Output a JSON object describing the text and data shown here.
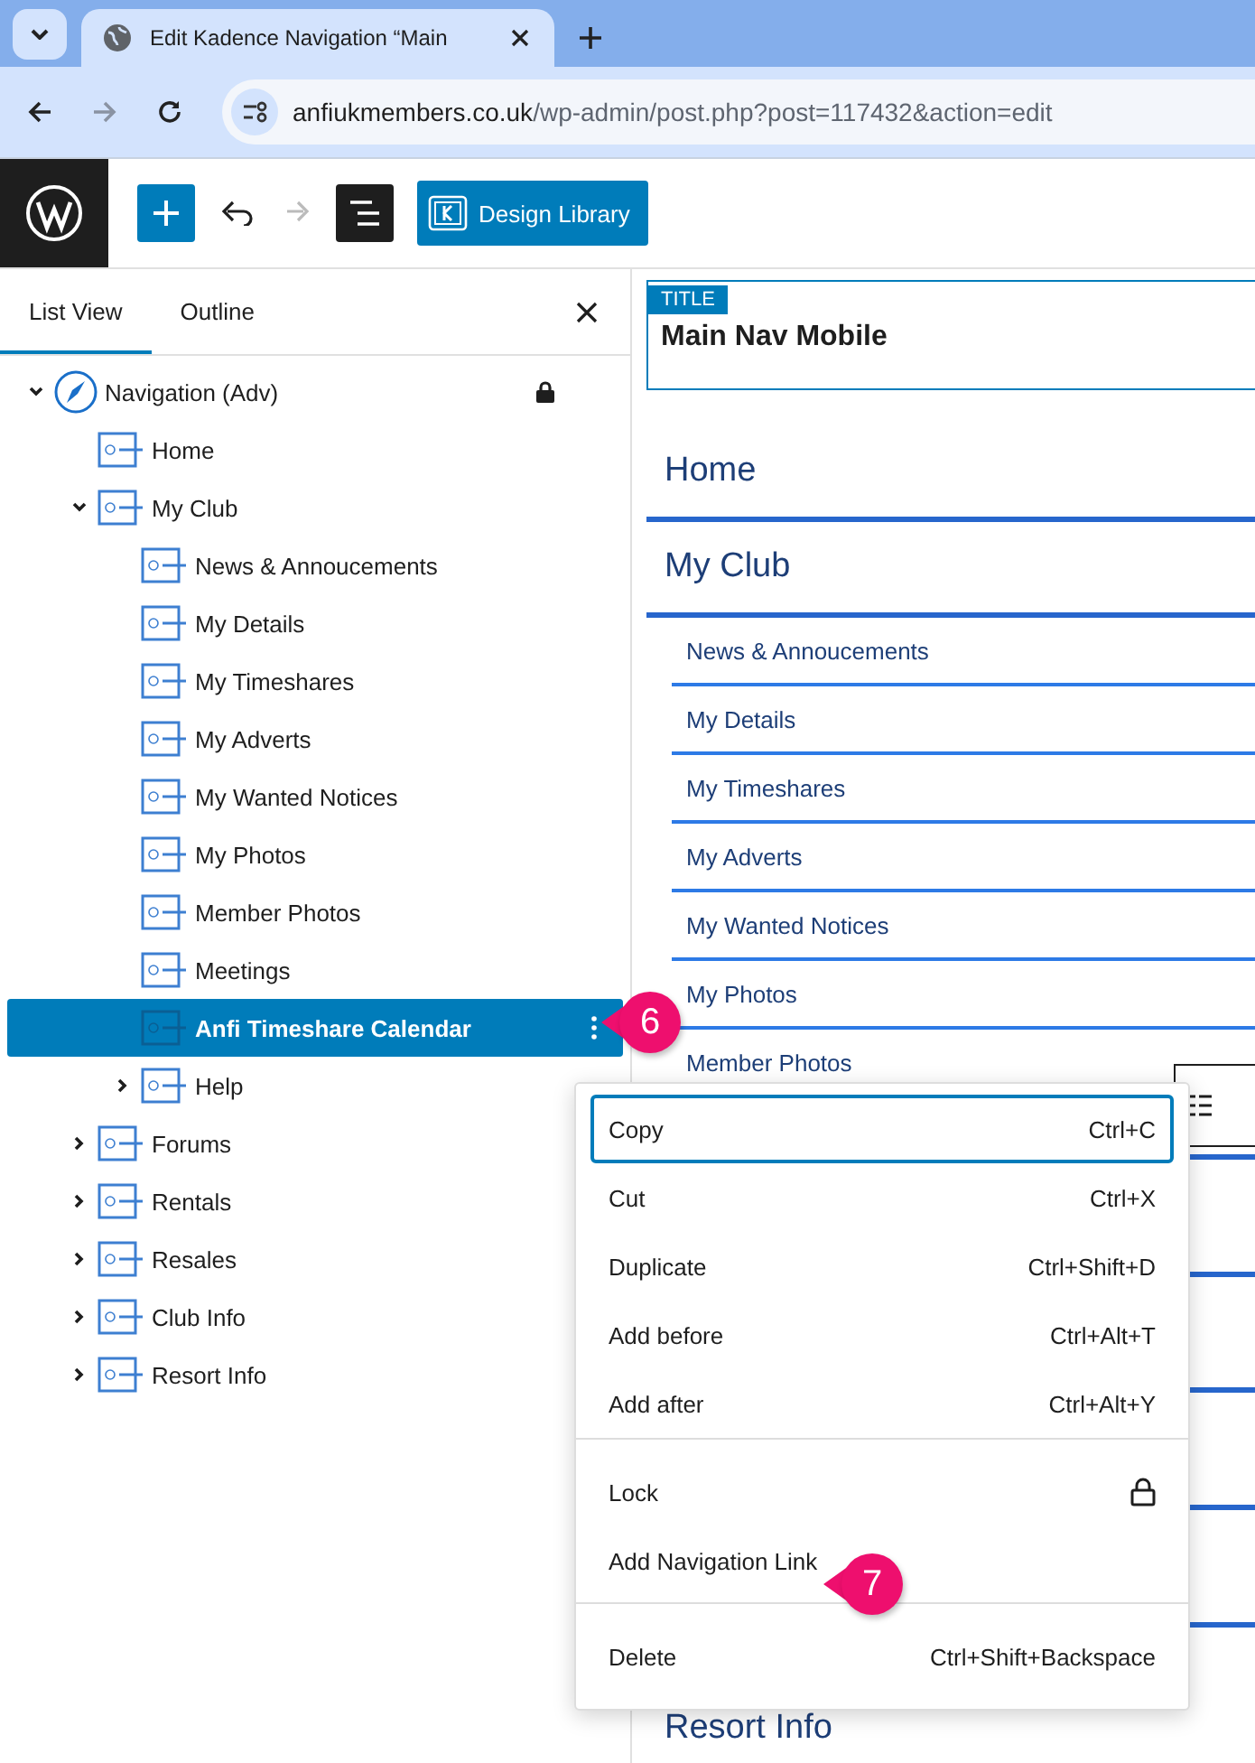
{
  "browser": {
    "tab_title": "Edit Kadence Navigation “Main",
    "address": {
      "domain": "anfiukmembers.co.uk",
      "path": "/wp-admin/post.php?post=117432&action=edit"
    }
  },
  "toolbar": {
    "library_button": "Design Library"
  },
  "list_panel": {
    "tabs": [
      {
        "label": "List View",
        "selected": true
      },
      {
        "label": "Outline",
        "selected": false
      }
    ],
    "tree": [
      {
        "label": "Navigation (Adv)",
        "kind": "navigation",
        "expanded": true,
        "locked": true,
        "selected": false,
        "children": [
          {
            "label": "Home",
            "kind": "link",
            "selected": false
          },
          {
            "label": "My Club",
            "kind": "link",
            "expanded": true,
            "selected": false,
            "children": [
              {
                "label": "News & Annoucements",
                "kind": "link",
                "selected": false
              },
              {
                "label": "My Details",
                "kind": "link",
                "selected": false
              },
              {
                "label": "My Timeshares",
                "kind": "link",
                "selected": false
              },
              {
                "label": "My Adverts",
                "kind": "link",
                "selected": false
              },
              {
                "label": "My Wanted Notices",
                "kind": "link",
                "selected": false
              },
              {
                "label": "My Photos",
                "kind": "link",
                "selected": false
              },
              {
                "label": "Member Photos",
                "kind": "link",
                "selected": false
              },
              {
                "label": "Meetings",
                "kind": "link",
                "selected": false
              },
              {
                "label": "Anfi Timeshare Calendar",
                "kind": "link",
                "selected": true
              },
              {
                "label": "Help",
                "kind": "link",
                "expanded": false,
                "selected": false
              }
            ]
          },
          {
            "label": "Forums",
            "kind": "link",
            "expanded": false,
            "selected": false
          },
          {
            "label": "Rentals",
            "kind": "link",
            "expanded": false,
            "selected": false
          },
          {
            "label": "Resales",
            "kind": "link",
            "expanded": false,
            "selected": false
          },
          {
            "label": "Club Info",
            "kind": "link",
            "expanded": false,
            "selected": false
          },
          {
            "label": "Resort Info",
            "kind": "link",
            "expanded": false,
            "selected": false
          }
        ]
      }
    ]
  },
  "canvas": {
    "title_tag": "TITLE",
    "title": "Main Nav Mobile",
    "menu": [
      {
        "label": "Home"
      },
      {
        "label": "My Club",
        "children": [
          {
            "label": "News & Annoucements"
          },
          {
            "label": "My Details"
          },
          {
            "label": "My Timeshares"
          },
          {
            "label": "My Adverts"
          },
          {
            "label": "My Wanted Notices"
          },
          {
            "label": "My Photos"
          },
          {
            "label": "Member Photos"
          }
        ]
      },
      {
        "label": "Resort Info"
      }
    ]
  },
  "context_menu": {
    "groups": [
      [
        {
          "label": "Copy",
          "shortcut": "Ctrl+C",
          "focused": true
        },
        {
          "label": "Cut",
          "shortcut": "Ctrl+X",
          "focused": false
        },
        {
          "label": "Duplicate",
          "shortcut": "Ctrl+Shift+D",
          "focused": false
        },
        {
          "label": "Add before",
          "shortcut": "Ctrl+Alt+T",
          "focused": false
        },
        {
          "label": "Add after",
          "shortcut": "Ctrl+Alt+Y",
          "focused": false
        }
      ],
      [
        {
          "label": "Lock",
          "kind": "lock",
          "focused": false
        },
        {
          "label": "Add Navigation Link",
          "focused": false
        }
      ],
      [
        {
          "label": "Delete",
          "shortcut": "Ctrl+Shift+Backspace",
          "focused": false
        }
      ]
    ]
  },
  "callouts": [
    {
      "number": "6"
    },
    {
      "number": "7"
    }
  ]
}
